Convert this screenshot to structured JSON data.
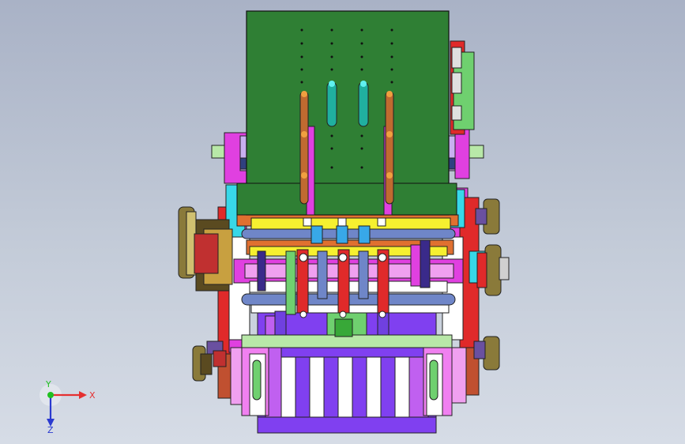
{
  "viewport": {
    "background_top": "#a9b2c6",
    "background_bottom": "#d6dce6"
  },
  "triad": {
    "x_label": "X",
    "y_label": "Y",
    "z_label": "Z",
    "x_color": "#e53030",
    "y_color": "#20c020",
    "z_color": "#2a3ad0"
  },
  "model": {
    "colors": {
      "top_plate": "#2f7f34",
      "right_board": "#6fd06f",
      "frame_magenta": "#e040e0",
      "frame_red": "#e02a2a",
      "frame_pink": "#f080f0",
      "bottom_purple": "#8040f0",
      "bottom_violet": "#c060f0",
      "rail_green": "#b8e8a8",
      "shaft_blue": "#6f86c8",
      "yellow": "#f6f030",
      "cyan": "#38d8e8",
      "orange": "#e07030",
      "gear_olive": "#8a7a3a",
      "gear_dark": "#5a4a20",
      "lavender": "#c8b0f0"
    }
  }
}
